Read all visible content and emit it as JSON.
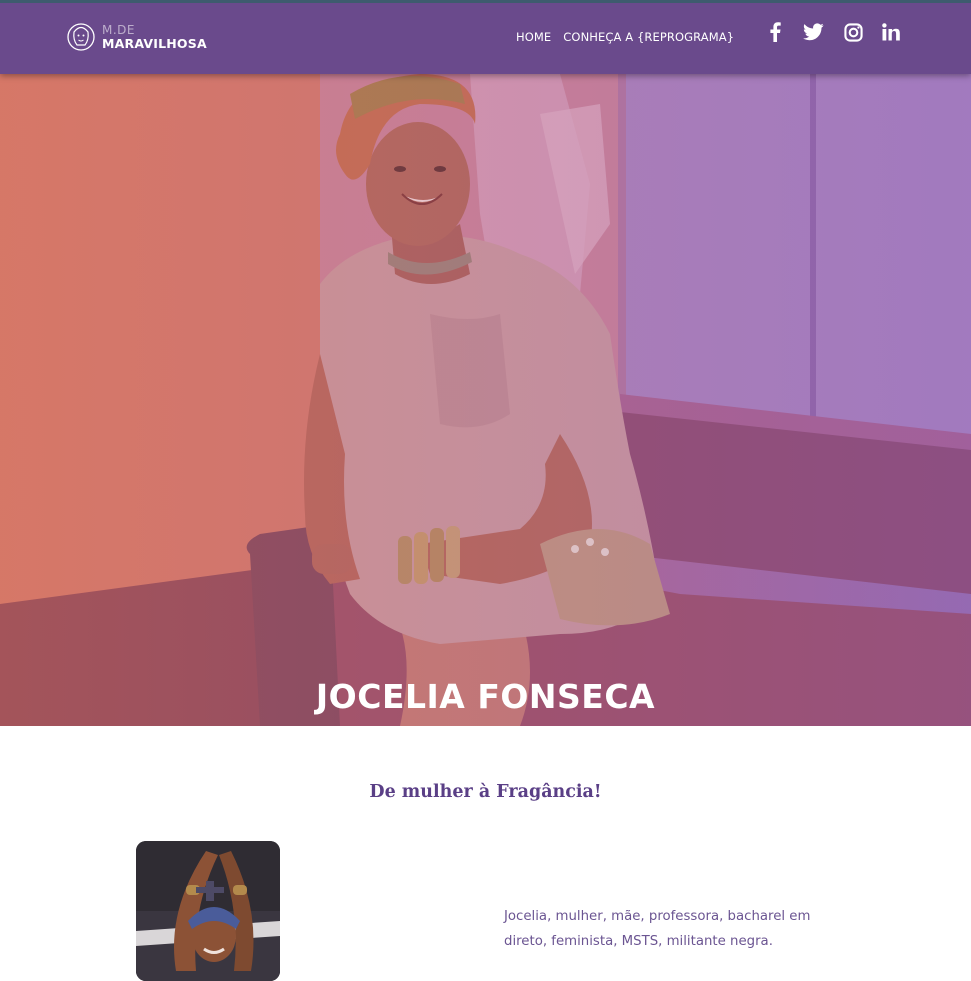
{
  "brand": {
    "line1": "M.DE",
    "line2": "MARAVILHOSA",
    "logo_icon": "woman-face-logo-icon"
  },
  "nav": [
    {
      "label": "HOME"
    },
    {
      "label": "CONHEÇA A {REPROGRAMA}"
    }
  ],
  "social": [
    "facebook-icon",
    "twitter-icon",
    "instagram-icon",
    "linkedin-icon"
  ],
  "hero": {
    "title": "JOCELIA FONSECA"
  },
  "content": {
    "subtitle": "De mulher à Fragância!",
    "bio": "Jocelia, mulher, mãe, professora, bacharel em direto, feminista, MSTS, militante negra."
  },
  "colors": {
    "navbar": "#6a4a8c",
    "accent": "#5a3f86",
    "text": "#6b5592"
  }
}
